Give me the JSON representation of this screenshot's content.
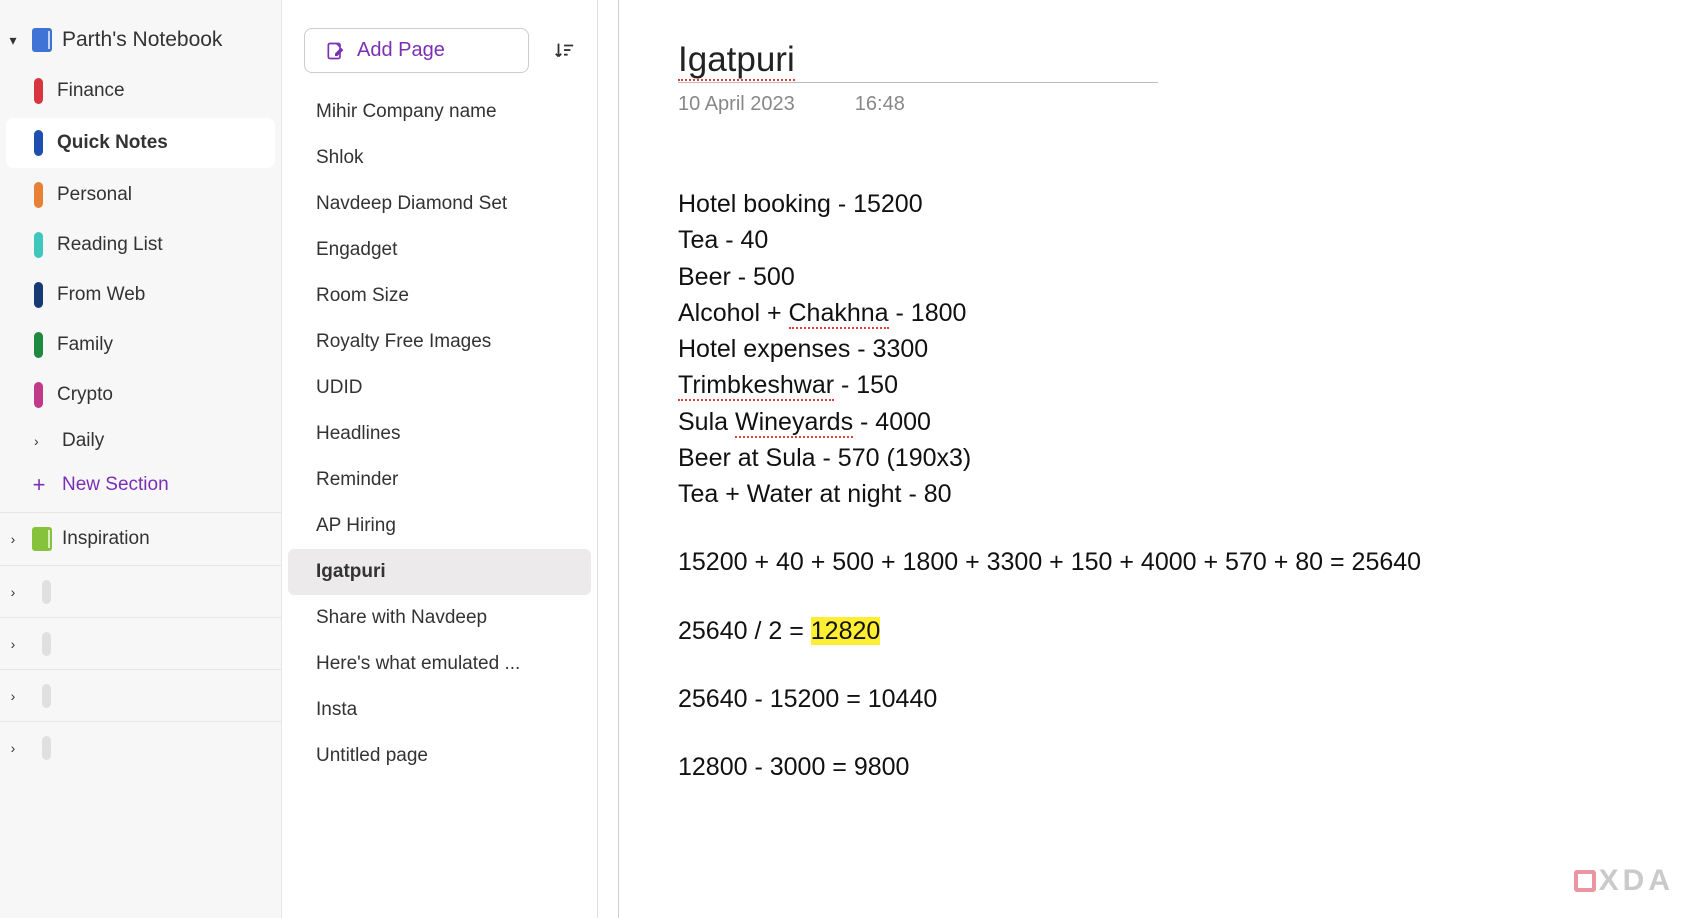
{
  "notebook": {
    "title": "Parth's Notebook",
    "sections": [
      {
        "label": "Finance",
        "color": "tab-red"
      },
      {
        "label": "Quick Notes",
        "color": "tab-blue",
        "active": true
      },
      {
        "label": "Personal",
        "color": "tab-orange"
      },
      {
        "label": "Reading List",
        "color": "tab-teal"
      },
      {
        "label": "From Web",
        "color": "tab-darkblue"
      },
      {
        "label": "Family",
        "color": "tab-green"
      },
      {
        "label": "Crypto",
        "color": "tab-pink"
      }
    ],
    "daily_label": "Daily",
    "new_section_label": "New Section",
    "inspiration_label": "Inspiration"
  },
  "pages": {
    "add_label": "Add Page",
    "items": [
      "Mihir Company name",
      "Shlok",
      "Navdeep Diamond Set",
      "Engadget",
      "Room Size",
      "Royalty Free Images",
      "UDID",
      "Headlines",
      "Reminder",
      "AP Hiring",
      "Igatpuri",
      "Share with Navdeep",
      "Here's what emulated ...",
      "Insta",
      "Untitled page"
    ],
    "selected_index": 10
  },
  "note": {
    "title": "Igatpuri",
    "date": "10 April 2023",
    "time": "16:48",
    "lines": [
      "Hotel booking - 15200",
      "Tea - 40",
      "Beer - 500",
      "Alcohol + Chakhna - 1800",
      "Hotel expenses - 3300",
      "Trimbkeshwar - 150",
      "Sula Wineyards - 4000",
      "Beer at Sula - 570 (190x3)",
      "Tea + Water at night - 80"
    ],
    "sum_line": "15200 + 40 + 500 + 1800 + 3300 + 150 + 4000 + 570 + 80 = 25640",
    "div_prefix": "25640 / 2 = ",
    "div_result": "12820",
    "sub1_line": "25640 - 15200 = 10440",
    "sub2_line": "12800 - 3000 = 9800"
  },
  "watermark": "XDA"
}
